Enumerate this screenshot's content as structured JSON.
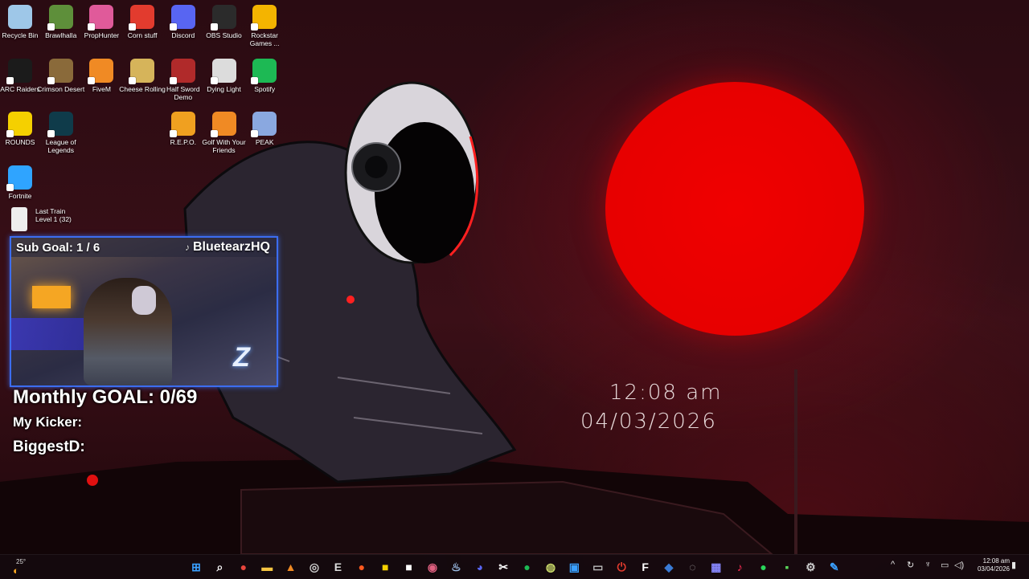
{
  "desktop": {
    "icons": [
      {
        "label": "Recycle Bin",
        "icon": "recycle-bin-icon",
        "color": "#9ec7e8"
      },
      {
        "label": "Brawlhalla",
        "icon": "brawlhalla-icon",
        "color": "#5e8f3a"
      },
      {
        "label": "PropHunter",
        "icon": "prophunter-icon",
        "color": "#e05a9a"
      },
      {
        "label": "Corn stuff",
        "icon": "power-icon",
        "color": "#e23b2e"
      },
      {
        "label": "Discord",
        "icon": "discord-icon",
        "color": "#5865f2"
      },
      {
        "label": "OBS Studio",
        "icon": "obs-icon",
        "color": "#2b2b2b"
      },
      {
        "label": "Rockstar Games ...",
        "icon": "rockstar-icon",
        "color": "#f4b400"
      },
      {
        "label": "ARC Raiders",
        "icon": "arc-raiders-icon",
        "color": "#1b1b1b"
      },
      {
        "label": "Crimson Desert",
        "icon": "crimson-desert-icon",
        "color": "#8a6a3a"
      },
      {
        "label": "FiveM",
        "icon": "fivem-icon",
        "color": "#f08a24"
      },
      {
        "label": "Cheese Rolling",
        "icon": "cheese-icon",
        "color": "#d6b45a"
      },
      {
        "label": "Half Sword Demo",
        "icon": "half-sword-icon",
        "color": "#b02a2a"
      },
      {
        "label": "Dying Light",
        "icon": "dying-light-icon",
        "color": "#dcdcdc"
      },
      {
        "label": "Spotify",
        "icon": "spotify-icon",
        "color": "#1db954"
      },
      {
        "label": "ROUNDS",
        "icon": "rounds-icon",
        "color": "#f5d000"
      },
      {
        "label": "League of Legends",
        "icon": "league-icon",
        "color": "#0f3b4a"
      },
      {
        "label": "R.E.P.O.",
        "icon": "repo-icon",
        "color": "#f0a020"
      },
      {
        "label": "Golf With Your Friends",
        "icon": "golf-icon",
        "color": "#f08a24"
      },
      {
        "label": "PEAK",
        "icon": "peak-icon",
        "color": "#8aa8e0"
      },
      {
        "label": "Fortnite",
        "icon": "fortnite-icon",
        "color": "#2fa4ff"
      }
    ],
    "last_train": {
      "title": "Last Train",
      "subtitle": "Level 1 (32)"
    },
    "clock": {
      "time": "12:08 am",
      "date": "04/03/2026"
    }
  },
  "overlay": {
    "sub_goal": "Sub Goal:  1 / 6",
    "handle": "BluetearzHQ",
    "monthly_goal": "Monthly GOAL: 0/69",
    "kicker_label": "My Kicker:",
    "biggest_label": "BiggestD:"
  },
  "taskbar": {
    "weather": "25°",
    "apps": [
      {
        "name": "start-button",
        "glyph": "⊞",
        "color": "#3aa0ff"
      },
      {
        "name": "search-icon",
        "glyph": "⌕",
        "color": "#ffffff"
      },
      {
        "name": "chrome-icon",
        "glyph": "●",
        "color": "#e8453c"
      },
      {
        "name": "file-explorer-icon",
        "glyph": "▬",
        "color": "#f5c542"
      },
      {
        "name": "vlc-icon",
        "glyph": "▲",
        "color": "#f08a24"
      },
      {
        "name": "obs-taskbar-icon",
        "glyph": "◎",
        "color": "#cccccc"
      },
      {
        "name": "epic-games-icon",
        "glyph": "E",
        "color": "#dddddd"
      },
      {
        "name": "browser-icon",
        "glyph": "●",
        "color": "#ff5a1f"
      },
      {
        "name": "notes-icon",
        "glyph": "■",
        "color": "#f5d000"
      },
      {
        "name": "editor-icon",
        "glyph": "■",
        "color": "#ffffff"
      },
      {
        "name": "app-icon",
        "glyph": "◉",
        "color": "#e06080"
      },
      {
        "name": "steam-icon",
        "glyph": "♨",
        "color": "#9fc1ea"
      },
      {
        "name": "discord-taskbar-icon",
        "glyph": "◕",
        "color": "#5865f2"
      },
      {
        "name": "capcut-icon",
        "glyph": "✂",
        "color": "#ffffff"
      },
      {
        "name": "spotify-taskbar-icon",
        "glyph": "●",
        "color": "#1db954"
      },
      {
        "name": "xbox-icon",
        "glyph": "◍",
        "color": "#c8d86a"
      },
      {
        "name": "photos-icon",
        "glyph": "▣",
        "color": "#3aa0ff"
      },
      {
        "name": "terminal-icon",
        "glyph": "▭",
        "color": "#bbbbbb"
      },
      {
        "name": "power-app-icon",
        "glyph": "⏻",
        "color": "#e23b2e"
      },
      {
        "name": "fivem-taskbar-icon",
        "glyph": "F",
        "color": "#ffffff"
      },
      {
        "name": "vpn-icon",
        "glyph": "◆",
        "color": "#3a7bd5"
      },
      {
        "name": "app2-icon",
        "glyph": "◌",
        "color": "#aaaaaa"
      },
      {
        "name": "mobile-icon",
        "glyph": "▦",
        "color": "#8888ff"
      },
      {
        "name": "tiktok-icon",
        "glyph": "♪",
        "color": "#ff2d55"
      },
      {
        "name": "chat-icon",
        "glyph": "●",
        "color": "#29d65a"
      },
      {
        "name": "kick-icon",
        "glyph": "▪",
        "color": "#5ad65a"
      },
      {
        "name": "settings-icon",
        "glyph": "⚙",
        "color": "#cccccc"
      },
      {
        "name": "paint-icon",
        "glyph": "✎",
        "color": "#3aa0ff"
      }
    ],
    "tray": {
      "time": "12:08 am",
      "date": "03/04/2026"
    }
  }
}
